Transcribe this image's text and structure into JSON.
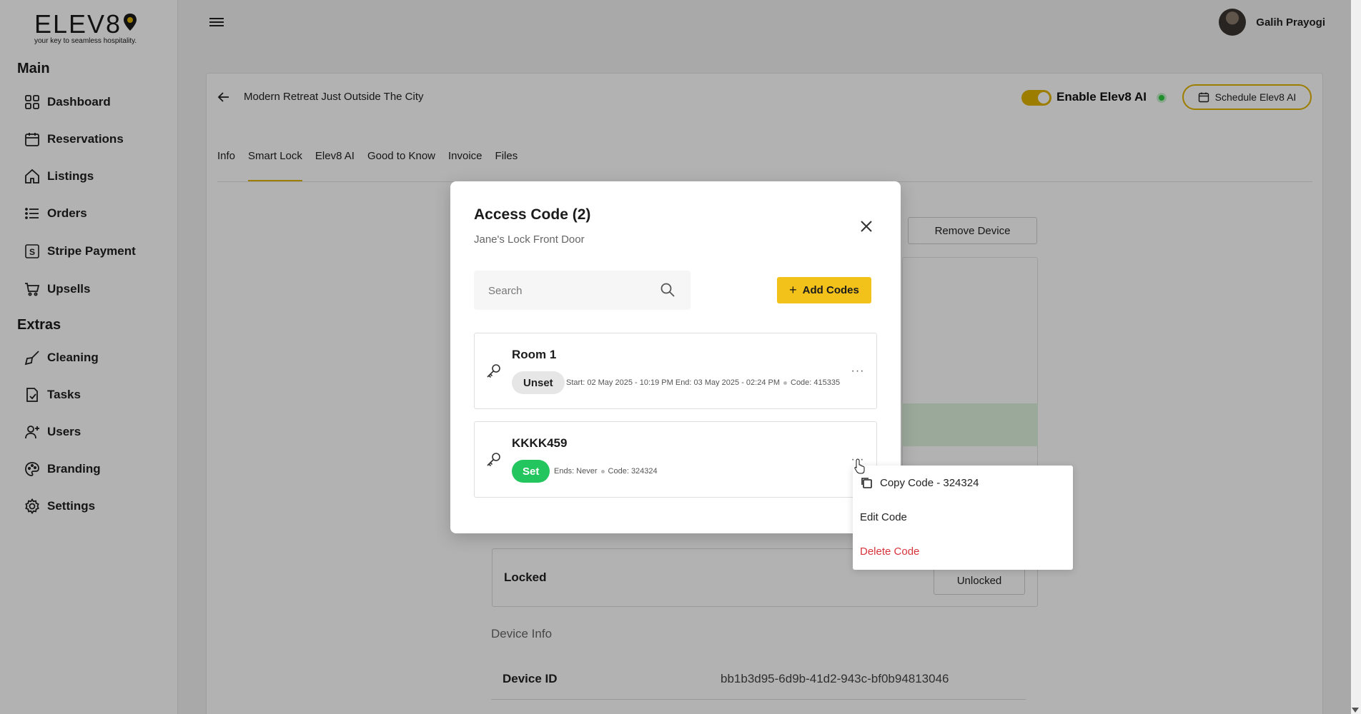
{
  "brand": {
    "logo_text": "ELEV8",
    "tagline": "your key to seamless hospitality."
  },
  "sidebar": {
    "sections": [
      {
        "title": "Main",
        "items": [
          {
            "label": "Dashboard",
            "icon": "grid-icon"
          },
          {
            "label": "Reservations",
            "icon": "calendar-icon"
          },
          {
            "label": "Listings",
            "icon": "home-icon"
          },
          {
            "label": "Orders",
            "icon": "list-icon"
          },
          {
            "label": "Stripe Payment",
            "icon": "stripe-icon"
          },
          {
            "label": "Upsells",
            "icon": "cart-icon"
          }
        ]
      },
      {
        "title": "Extras",
        "items": [
          {
            "label": "Cleaning",
            "icon": "broom-icon"
          },
          {
            "label": "Tasks",
            "icon": "task-icon"
          },
          {
            "label": "Users",
            "icon": "user-add-icon"
          },
          {
            "label": "Branding",
            "icon": "palette-icon"
          },
          {
            "label": "Settings",
            "icon": "gear-icon"
          }
        ]
      }
    ]
  },
  "header": {
    "user_name": "Galih Prayogi"
  },
  "listing": {
    "title": "Modern Retreat Just Outside The City",
    "enable_label": "Enable Elev8 AI",
    "enable_on": true,
    "schedule_label": "Schedule Elev8 AI",
    "tabs": [
      "Info",
      "Smart Lock",
      "Elev8 AI",
      "Good to Know",
      "Invoice",
      "Files"
    ],
    "active_tab": "Smart Lock"
  },
  "device": {
    "remove_label": "Remove Device",
    "lock_state": "Locked",
    "unlock_button": "Unlocked",
    "info_heading": "Device Info",
    "id_label": "Device ID",
    "id_value": "bb1b3d95-6d9b-41d2-943c-bf0b94813046"
  },
  "modal": {
    "title": "Access Code (2)",
    "subtitle": "Jane's Lock Front Door",
    "search_placeholder": "Search",
    "add_button": "Add Codes",
    "codes": [
      {
        "name": "Room 1",
        "status": "Unset",
        "schedule": "Start: 02 May 2025 - 10:19 PM End: 03 May 2025 - 02:24 PM",
        "code": "Code: 415335"
      },
      {
        "name": "KKKK459",
        "status": "Set",
        "schedule": "Ends: Never",
        "code": "Code: 324324"
      }
    ]
  },
  "menu": {
    "copy": "Copy Code - 324324",
    "edit": "Edit Code",
    "delete": "Delete Code"
  },
  "colors": {
    "accent": "#f2c21b",
    "success": "#22c55e",
    "danger": "#d6333b"
  }
}
